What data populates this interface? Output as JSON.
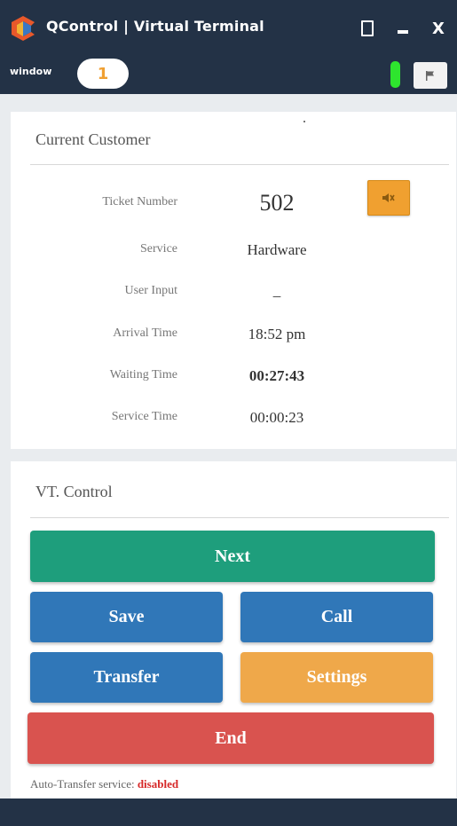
{
  "window": {
    "title": "QControl | Virtual Terminal",
    "maximize_icon": "maximize-icon",
    "minimize_label": "-",
    "close_label": "X"
  },
  "toolbar": {
    "window_label": "window",
    "window_number": "1",
    "status_color": "#2ee52e",
    "flag_icon": "flag-icon"
  },
  "current_customer": {
    "title": "Current Customer",
    "rows": [
      {
        "label": "Ticket Number",
        "value": "502"
      },
      {
        "label": "Service",
        "value": "Hardware"
      },
      {
        "label": "User Input",
        "value": "_"
      },
      {
        "label": "Arrival Time",
        "value": "18:52 pm"
      },
      {
        "label": "Waiting Time",
        "value": "00:27:43"
      },
      {
        "label": "Service Time",
        "value": "00:00:23"
      }
    ],
    "mute_icon": "speaker-mute-icon"
  },
  "vt_control": {
    "title": "VT. Control",
    "next_label": "Next",
    "save_label": "Save",
    "call_label": "Call",
    "transfer_label": "Transfer",
    "settings_label": "Settings",
    "end_label": "End"
  },
  "status": {
    "auto_transfer_label": "Auto-Transfer service:",
    "auto_transfer_value": "disabled"
  },
  "colors": {
    "header_bg": "#233246",
    "next": "#1e9e7c",
    "save_call_transfer": "#3077b8",
    "settings": "#efa84a",
    "end": "#d9534f",
    "disabled_text": "#d62828"
  }
}
